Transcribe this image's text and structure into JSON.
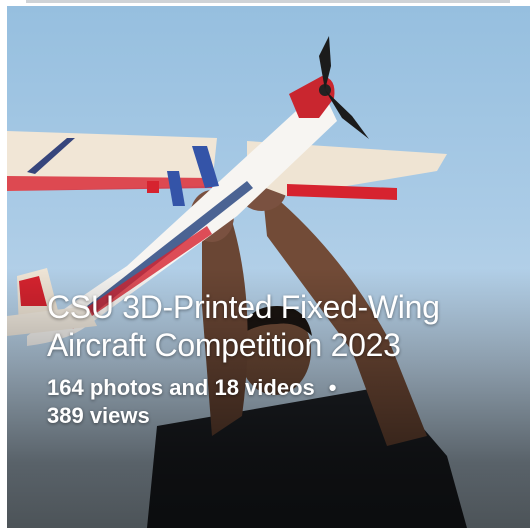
{
  "album": {
    "title": "CSU 3D-Printed Fixed-Wing Aircraft Competition 2023",
    "photo_count_text": "164 photos and 18 videos",
    "separator": "•",
    "views_text": "389 views"
  }
}
